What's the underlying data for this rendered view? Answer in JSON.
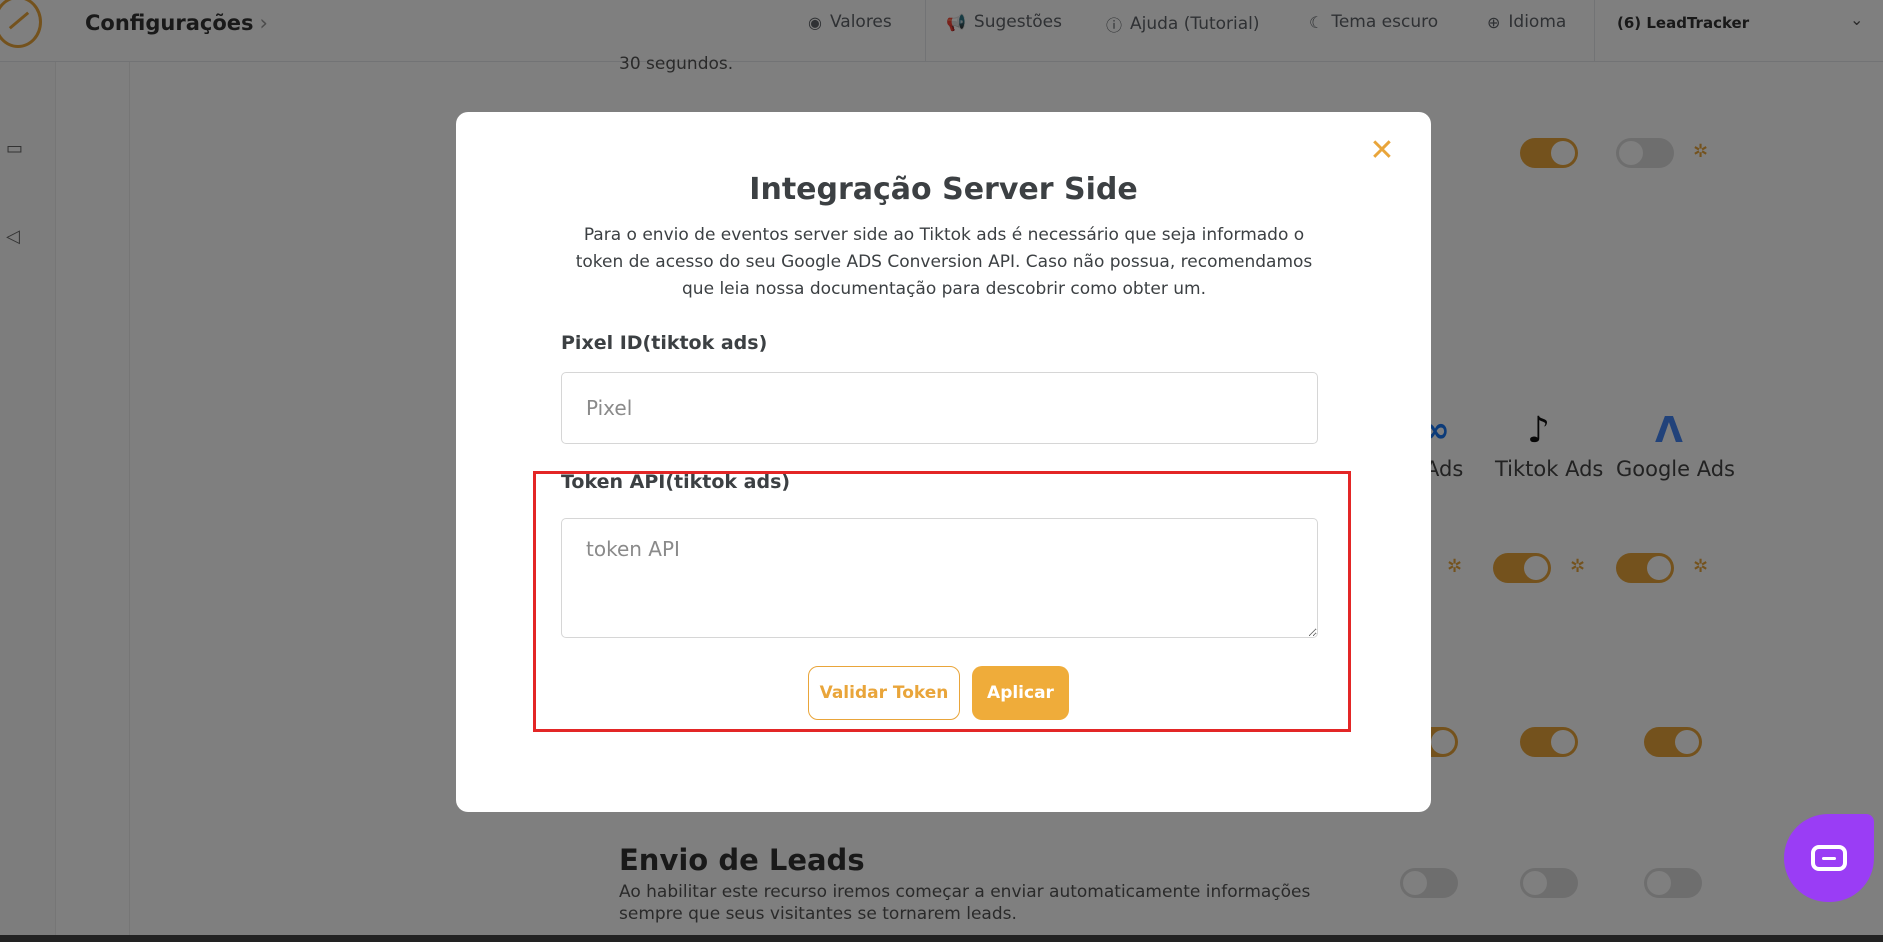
{
  "header": {
    "title": "Configurações",
    "nav": [
      {
        "label": "Valores",
        "icon": "eye-icon"
      },
      {
        "label": "Sugestões",
        "icon": "megaphone-icon"
      },
      {
        "label": "Ajuda (Tutorial)",
        "icon": "help-circle-icon"
      },
      {
        "label": "Tema escuro",
        "icon": "moon-icon"
      },
      {
        "label": "Idioma",
        "icon": "globe-icon"
      }
    ],
    "account": "(6) LeadTracker"
  },
  "background": {
    "top_text": "30 segundos.",
    "platforms": [
      "Ads",
      "Tiktok Ads",
      "Google Ads"
    ],
    "section_heading": "Envio de Leads",
    "section_desc": "Ao habilitar este recurso iremos começar a enviar automaticamente informações sempre que seus visitantes se tornarem leads."
  },
  "modal": {
    "title": "Integração Server Side",
    "description": "Para o envio de eventos server side ao Tiktok ads é necessário que seja informado o token de acesso do seu Google ADS Conversion API. Caso não possua, recomendamos que leia nossa documentação para descobrir como obter um.",
    "pixel_label": "Pixel ID(tiktok ads)",
    "pixel_placeholder": "Pixel",
    "token_label": "Token API(tiktok ads)",
    "token_placeholder": "token API",
    "validate_button": "Validar Token",
    "apply_button": "Aplicar",
    "close_icon": "close-icon"
  },
  "colors": {
    "accent": "#e9a53a",
    "highlight": "#e32626",
    "chat": "#9a3df5"
  }
}
